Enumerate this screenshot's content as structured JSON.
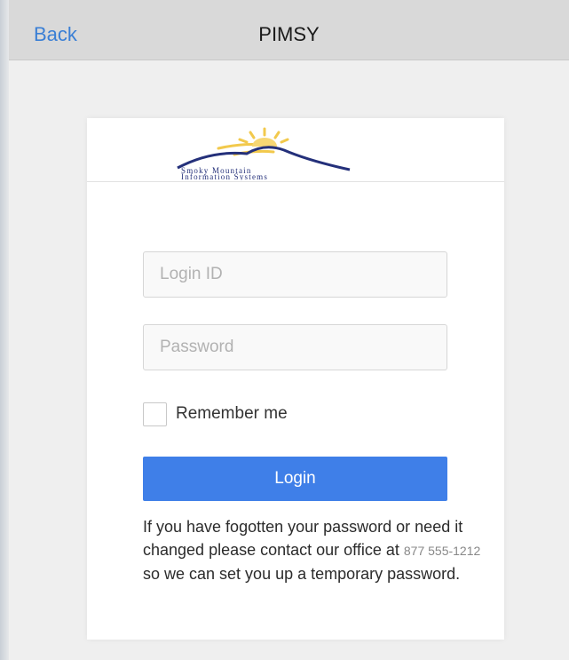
{
  "navbar": {
    "back_label": "Back",
    "title": "PIMSY"
  },
  "logo": {
    "line1": "Smoky Mountain",
    "line2": "Information Systems",
    "colors": {
      "sun": "#f2c94c",
      "mountain": "#24307a"
    }
  },
  "form": {
    "login_placeholder": "Login ID",
    "login_value": "",
    "password_placeholder": "Password",
    "password_value": "",
    "remember_label": "Remember me",
    "remember_checked": false,
    "login_button": "Login"
  },
  "help": {
    "text_before": "If you have fogotten your password or need it changed please contact our office at ",
    "phone": "877 555-1212",
    "text_after": " so we can set you up a temporary password."
  },
  "colors": {
    "accent": "#3f7fe8",
    "link": "#3a7fd5"
  }
}
